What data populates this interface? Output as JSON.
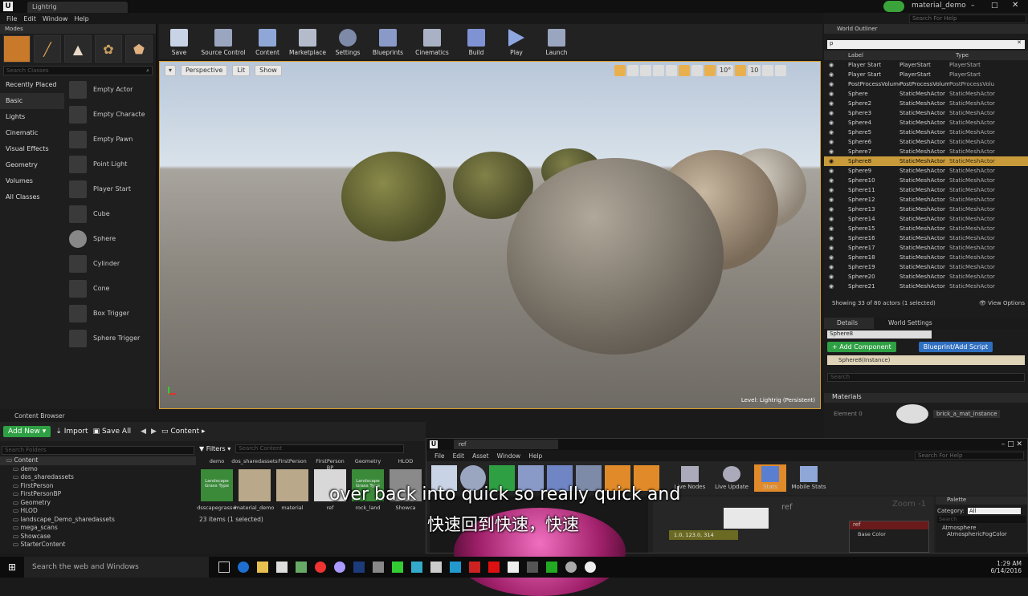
{
  "window": {
    "tab": "Lightrig",
    "project": "material_demo",
    "help_search": "Search For Help"
  },
  "menu": [
    "File",
    "Edit",
    "Window",
    "Help"
  ],
  "modes": {
    "title": "Modes",
    "search_placeholder": "Search Classes",
    "categories": [
      "Recently Placed",
      "Basic",
      "Lights",
      "Cinematic",
      "Visual Effects",
      "Geometry",
      "Volumes",
      "All Classes"
    ],
    "items": [
      "Empty Actor",
      "Empty Characte",
      "Empty Pawn",
      "Point Light",
      "Player Start",
      "Cube",
      "Sphere",
      "Cylinder",
      "Cone",
      "Box Trigger",
      "Sphere Trigger"
    ]
  },
  "toolbar": [
    "Save",
    "Source Control",
    "Content",
    "Marketplace",
    "Settings",
    "Blueprints",
    "Cinematics",
    "Build",
    "Play",
    "Launch"
  ],
  "viewport": {
    "perspective": "Perspective",
    "lit": "Lit",
    "show": "Show",
    "level_label": "Level:  Lightrig (Persistent)",
    "snap_angle": "10°",
    "snap_scale": "10"
  },
  "outliner": {
    "title": "World Outliner",
    "search_value": "p",
    "col_label": "Label",
    "col_type": "Type",
    "rows": [
      [
        "Player Start",
        "PlayerStart",
        "PlayerStart"
      ],
      [
        "Player Start",
        "PlayerStart",
        "PlayerStart"
      ],
      [
        "PostProcessVolume",
        "PostProcessVolume",
        "PostProcessVolu"
      ],
      [
        "Sphere",
        "StaticMeshActor",
        "StaticMeshActor"
      ],
      [
        "Sphere2",
        "StaticMeshActor",
        "StaticMeshActor"
      ],
      [
        "Sphere3",
        "StaticMeshActor",
        "StaticMeshActor"
      ],
      [
        "Sphere4",
        "StaticMeshActor",
        "StaticMeshActor"
      ],
      [
        "Sphere5",
        "StaticMeshActor",
        "StaticMeshActor"
      ],
      [
        "Sphere6",
        "StaticMeshActor",
        "StaticMeshActor"
      ],
      [
        "Sphere7",
        "StaticMeshActor",
        "StaticMeshActor"
      ],
      [
        "Sphere8",
        "StaticMeshActor",
        "StaticMeshActor"
      ],
      [
        "Sphere9",
        "StaticMeshActor",
        "StaticMeshActor"
      ],
      [
        "Sphere10",
        "StaticMeshActor",
        "StaticMeshActor"
      ],
      [
        "Sphere11",
        "StaticMeshActor",
        "StaticMeshActor"
      ],
      [
        "Sphere12",
        "StaticMeshActor",
        "StaticMeshActor"
      ],
      [
        "Sphere13",
        "StaticMeshActor",
        "StaticMeshActor"
      ],
      [
        "Sphere14",
        "StaticMeshActor",
        "StaticMeshActor"
      ],
      [
        "Sphere15",
        "StaticMeshActor",
        "StaticMeshActor"
      ],
      [
        "Sphere16",
        "StaticMeshActor",
        "StaticMeshActor"
      ],
      [
        "Sphere17",
        "StaticMeshActor",
        "StaticMeshActor"
      ],
      [
        "Sphere18",
        "StaticMeshActor",
        "StaticMeshActor"
      ],
      [
        "Sphere19",
        "StaticMeshActor",
        "StaticMeshActor"
      ],
      [
        "Sphere20",
        "StaticMeshActor",
        "StaticMeshActor"
      ],
      [
        "Sphere21",
        "StaticMeshActor",
        "StaticMeshActor"
      ]
    ],
    "selected_index": 10,
    "status": "Showing 33 of 80 actors (1 selected)",
    "view_options": "View Options"
  },
  "details": {
    "tab1": "Details",
    "tab2": "World Settings",
    "name_value": "Sphere8",
    "add_component": "+ Add Component",
    "blueprint": "Blueprint/Add Script",
    "instance": "Sphere8(Instance)",
    "search_placeholder": "Search",
    "materials_header": "Materials",
    "element_label": "Element 0",
    "material_value": "brick_a_mat_instance"
  },
  "content_browser": {
    "title": "Content Browser",
    "add_new": "Add New",
    "import": "Import",
    "save_all": "Save All",
    "path": "Content",
    "search_folders": "Search Folders",
    "filters": "Filters",
    "search_content": "Search Content",
    "folders": [
      "Content",
      "demo",
      "dos_sharedassets",
      "FirstPerson",
      "FirstPersonBP",
      "Geometry",
      "HLOD",
      "landscape_Demo_sharedassets",
      "mega_scans",
      "Showcase",
      "StarterContent"
    ],
    "asset_headers": [
      "demo",
      "dos_sharedassets",
      "FirstPerson",
      "FirstPerson BP",
      "Geometry",
      "HLOD"
    ],
    "assets": [
      "dsscapegrass#",
      "material_demo",
      "material",
      "ref",
      "rock_land",
      "Showca"
    ],
    "asset_badges": [
      "Landscape Grass Type",
      "",
      "",
      "",
      "Landscape Grass Type",
      ""
    ],
    "count": "23 items (1 selected)"
  },
  "material_editor": {
    "tab": "ref",
    "menu": [
      "File",
      "Edit",
      "Asset",
      "Window",
      "Help"
    ],
    "help_search": "Search For Help",
    "toolbar": [
      "Live Nodes",
      "Live Update",
      "Stats",
      "Mobile Stats"
    ],
    "graph_label": "ref",
    "zoom": "Zoom -1",
    "node_title": "ref",
    "node_pin": "Base Color",
    "value_node": "1.0, 123.0, 314",
    "palette_title": "Palette",
    "category_label": "Category:",
    "category_value": "All",
    "palette_search": "Search",
    "palette_items": [
      "Atmosphere",
      "AtmosphericFogColor"
    ]
  },
  "subtitles": {
    "en": "over back into quick so really quick and",
    "zh": "快速回到快速，快速"
  },
  "taskbar": {
    "search": "Search the web and Windows",
    "time": "1:29 AM",
    "date": "6/14/2016"
  }
}
